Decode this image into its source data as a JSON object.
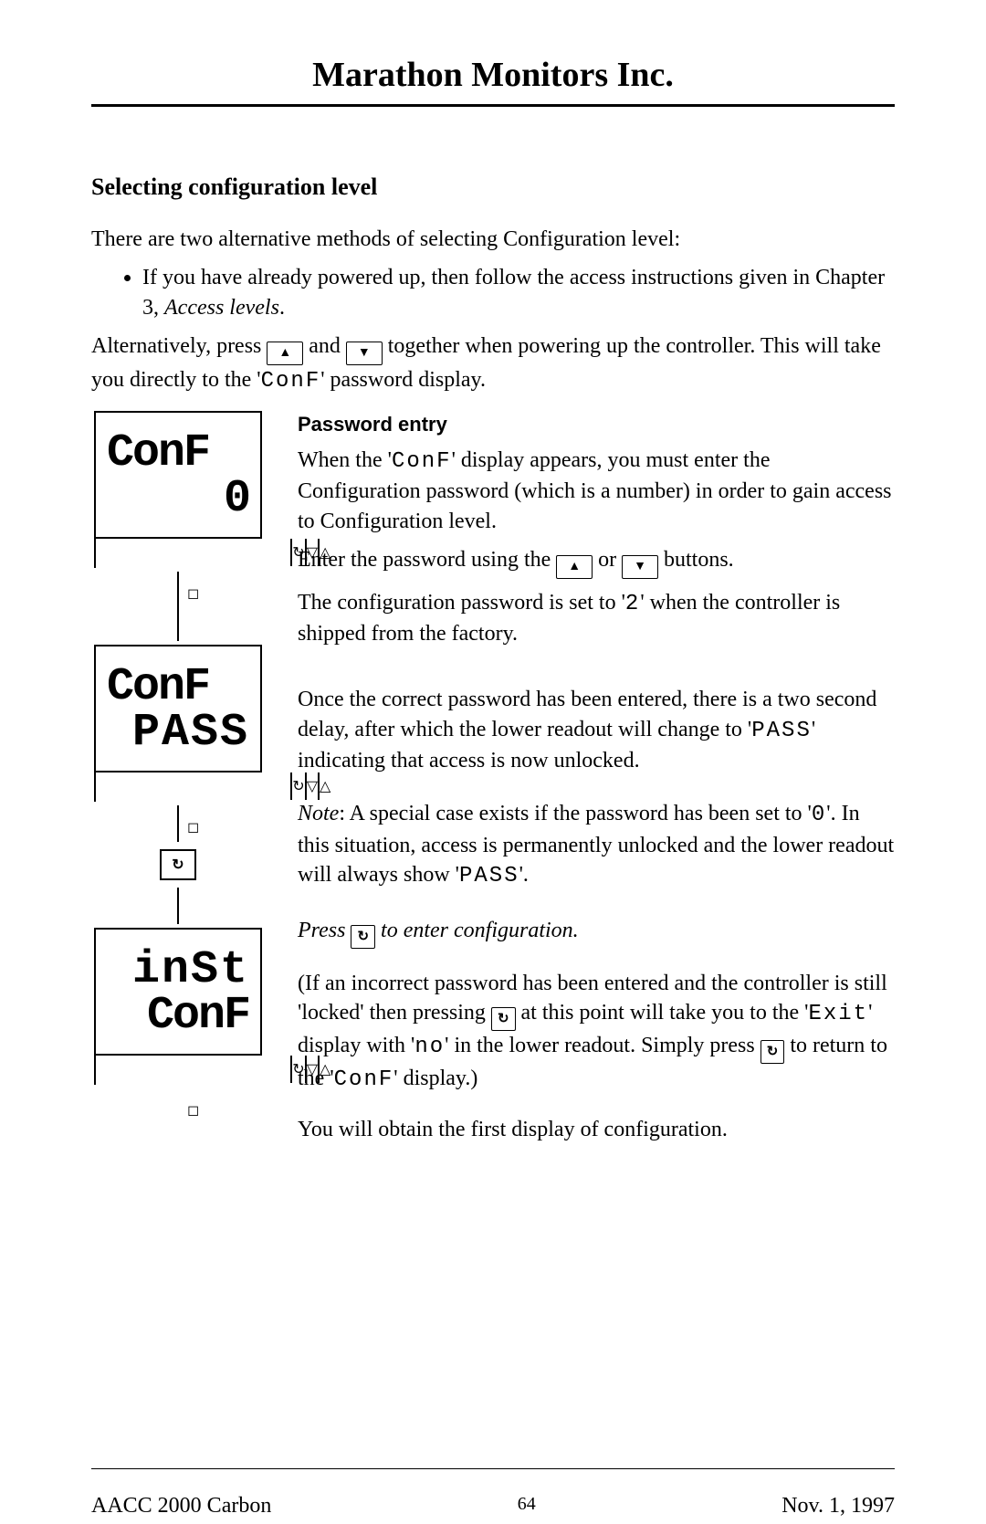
{
  "header": {
    "company": "Marathon Monitors Inc."
  },
  "section": {
    "heading": "Selecting configuration level"
  },
  "intro": {
    "line": "There are two alternative methods of selecting Configuration level:",
    "bullet_pre": "If you have already powered up, then follow the access instructions given in Chapter 3, ",
    "bullet_italic": "Access levels",
    "bullet_post": "."
  },
  "alt": {
    "p1a": "Alternatively, press ",
    "p1b": " and ",
    "p1c": " together when powering up the controller.   This will take you directly to the '",
    "code1": "ConF",
    "p1d": "' password display."
  },
  "pw": {
    "heading": "Password entry",
    "p1a": "When the '",
    "code1": "ConF",
    "p1b": "' display appears, you must enter the Configuration password (which is a number) in order to gain access to Configuration level.",
    "p2a": "Enter the password using the ",
    "p2b": " or ",
    "p2c": " buttons.",
    "p3a": "The configuration password is set to '",
    "code2": "2",
    "p3b": "' when the controller is shipped from the factory."
  },
  "pass": {
    "p1a": "Once the correct password has been entered, there is a two second delay, after which the lower readout will change to '",
    "code1": "PASS",
    "p1b": "' indicating that access is now unlocked.",
    "note_label": "Note",
    "note_a": ":  A special case exists if the password has been set to '",
    "code2": "0",
    "note_b": "'.  In this situation, access is permanently unlocked and the lower readout will always show '",
    "code3": "PASS",
    "note_c": "'.",
    "press_a": "Press ",
    "press_b": " to enter configuration.",
    "incorrect_a": "(If an incorrect password has been entered and the controller is still 'locked' then pressing ",
    "incorrect_b": " at this point will take you to the '",
    "code_exit": "Exit",
    "incorrect_c": "' display with '",
    "code_no": "no",
    "incorrect_d": "' in the lower readout.  Simply press ",
    "incorrect_e": " to return to the '",
    "code_conf": "ConF",
    "incorrect_f": "' display.)",
    "last": "You will obtain the first display of configuration."
  },
  "devices": {
    "d1_top": "ConF",
    "d1_bot": "0",
    "d2_top": "ConF",
    "d2_bot": "PASS",
    "d3_top": "inSt",
    "d3_bot": "ConF"
  },
  "footer": {
    "left": "AACC 2000 Carbon",
    "page": "64",
    "right": "Nov.  1, 1997"
  }
}
